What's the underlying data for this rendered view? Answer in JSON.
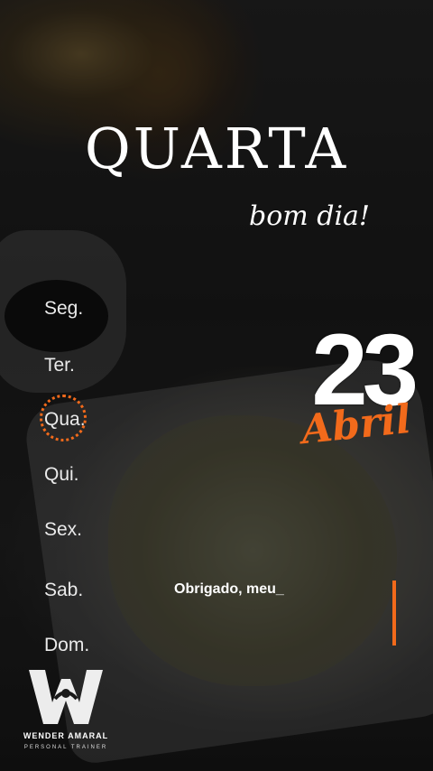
{
  "header": {
    "weekday_title": "QUARTA",
    "greeting": "bom dia!"
  },
  "week": {
    "days": [
      "Seg.",
      "Ter.",
      "Qua.",
      "Qui.",
      "Sex.",
      "Sab.",
      "Dom."
    ],
    "selected": "Qua."
  },
  "date": {
    "day": "23",
    "month": "Abril"
  },
  "message": {
    "text": "Obrigado, meu_"
  },
  "brand": {
    "name": "WENDER AMARAL",
    "tagline": "PERSONAL TRAINER",
    "logo_icon": "w-logo-icon"
  },
  "colors": {
    "accent": "#f26a1b",
    "text": "#ffffff"
  }
}
